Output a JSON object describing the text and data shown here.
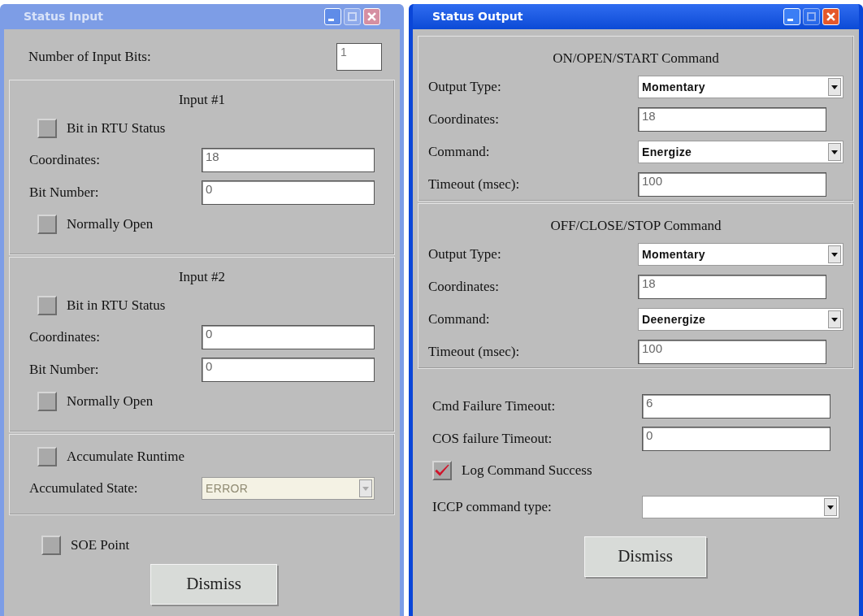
{
  "windows": [
    {
      "title": "Status Input",
      "active": false,
      "kind": "input",
      "number_of_input_bits": {
        "label": "Number of Input Bits:",
        "value": "1"
      },
      "inputs": [
        {
          "heading": "Input #1",
          "bit_in_rtu_status": {
            "label": "Bit in RTU Status",
            "checked": false
          },
          "coordinates": {
            "label": "Coordinates:",
            "value": "18"
          },
          "bit_number": {
            "label": "Bit Number:",
            "value": "0"
          },
          "normally_open": {
            "label": "Normally Open",
            "checked": false
          }
        },
        {
          "heading": "Input #2",
          "bit_in_rtu_status": {
            "label": "Bit in RTU Status",
            "checked": false
          },
          "coordinates": {
            "label": "Coordinates:",
            "value": "0"
          },
          "bit_number": {
            "label": "Bit Number:",
            "value": "0"
          },
          "normally_open": {
            "label": "Normally Open",
            "checked": false
          }
        }
      ],
      "accumulate_runtime": {
        "label": "Accumulate Runtime",
        "checked": false
      },
      "accumulated_state": {
        "label": "Accumulated State:",
        "value": "ERROR",
        "disabled": true
      },
      "soe_point": {
        "label": "SOE Point",
        "checked": false
      },
      "dismiss": "Dismiss"
    },
    {
      "title": "Status Output",
      "active": true,
      "kind": "output",
      "commands": [
        {
          "heading": "ON/OPEN/START Command",
          "output_type": {
            "label": "Output Type:",
            "value": "Momentary"
          },
          "coordinates": {
            "label": "Coordinates:",
            "value": "18"
          },
          "command": {
            "label": "Command:",
            "value": "Energize"
          },
          "timeout": {
            "label": "Timeout (msec):",
            "value": "100"
          }
        },
        {
          "heading": "OFF/CLOSE/STOP Command",
          "output_type": {
            "label": "Output Type:",
            "value": "Momentary"
          },
          "coordinates": {
            "label": "Coordinates:",
            "value": "18"
          },
          "command": {
            "label": "Command:",
            "value": "Deenergize"
          },
          "timeout": {
            "label": "Timeout (msec):",
            "value": "100"
          }
        }
      ],
      "cmd_failure_timeout": {
        "label": "Cmd Failure Timeout:",
        "value": "6"
      },
      "cos_failure_timeout": {
        "label": "COS failure Timeout:",
        "value": "0"
      },
      "log_command_success": {
        "label": "Log Command Success",
        "checked": true
      },
      "iccp_command_type": {
        "label": "ICCP command type:"
      },
      "dismiss": "Dismiss"
    }
  ]
}
